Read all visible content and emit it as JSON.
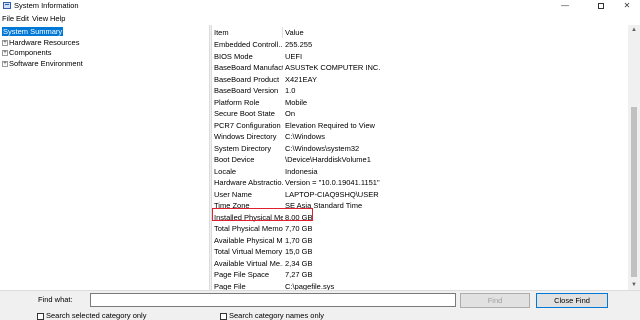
{
  "window": {
    "title": "System Information",
    "controls": {
      "minimize": "—",
      "close": "✕"
    }
  },
  "menu": [
    "File",
    "Edit",
    "View",
    "Help"
  ],
  "tree": [
    {
      "label": "System Summary",
      "selected": true,
      "expander": ""
    },
    {
      "label": "Hardware Resources",
      "selected": false,
      "expander": "+"
    },
    {
      "label": "Components",
      "selected": false,
      "expander": "+"
    },
    {
      "label": "Software Environment",
      "selected": false,
      "expander": "+"
    }
  ],
  "table": {
    "columns": [
      "Item",
      "Value"
    ],
    "rows": [
      {
        "item": "Embedded Controll...",
        "value": "255.255"
      },
      {
        "item": "BIOS Mode",
        "value": "UEFI"
      },
      {
        "item": "BaseBoard Manufact...",
        "value": "ASUSTeK COMPUTER INC."
      },
      {
        "item": "BaseBoard Product",
        "value": "X421EAY"
      },
      {
        "item": "BaseBoard Version",
        "value": "1.0"
      },
      {
        "item": "Platform Role",
        "value": "Mobile"
      },
      {
        "item": "Secure Boot State",
        "value": "On"
      },
      {
        "item": "PCR7 Configuration",
        "value": "Elevation Required to View"
      },
      {
        "item": "Windows Directory",
        "value": "C:\\Windows"
      },
      {
        "item": "System Directory",
        "value": "C:\\Windows\\system32"
      },
      {
        "item": "Boot Device",
        "value": "\\Device\\HarddiskVolume1"
      },
      {
        "item": "Locale",
        "value": "Indonesia"
      },
      {
        "item": "Hardware Abstractio...",
        "value": "Version = \"10.0.19041.1151\""
      },
      {
        "item": "User Name",
        "value": "LAPTOP-CIAQ9SHQ\\USER"
      },
      {
        "item": "Time Zone",
        "value": "SE Asia Standard Time"
      },
      {
        "item": "Installed Physical Me...",
        "value": "8,00 GB"
      },
      {
        "item": "Total Physical Memo...",
        "value": "7,70 GB"
      },
      {
        "item": "Available Physical M...",
        "value": "1,70 GB"
      },
      {
        "item": "Total Virtual Memory",
        "value": "15,0 GB"
      },
      {
        "item": "Available Virtual Me...",
        "value": "2,34 GB"
      },
      {
        "item": "Page File Space",
        "value": "7,27 GB"
      },
      {
        "item": "Page File",
        "value": "C:\\pagefile.sys"
      }
    ],
    "highlighted_row": "Installed Physical Me..."
  },
  "find": {
    "label": "Find what:",
    "value": "",
    "find_button": "Find",
    "close_button": "Close Find",
    "option_selected_category": "Search selected category only",
    "option_category_names": "Search category names only"
  },
  "colors": {
    "selection": "#0078d7",
    "highlight_border": "#e0202a"
  }
}
